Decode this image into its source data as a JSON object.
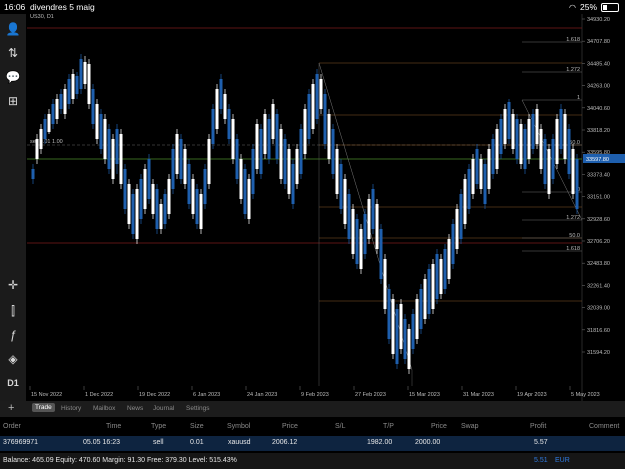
{
  "status": {
    "time": "16:06",
    "date": "divendres 5 maig",
    "battery": "25%"
  },
  "chart": {
    "symbol": "US30, D1",
    "sell_label": "sell 0.01 1.00",
    "price_ticks": [
      "34930.20",
      "34707.80",
      "34485.40",
      "34263.00",
      "34040.60",
      "33818.20",
      "33595.80",
      "33373.40",
      "33151.00",
      "32928.60",
      "32706.20",
      "32483.80",
      "32261.40",
      "32039.00",
      "31816.60",
      "31594.20"
    ],
    "current_price": "33597.80",
    "date_ticks": [
      "15 Nov 2022",
      "1 Dec 2022",
      "19 Dec 2022",
      "6 Jan 2023",
      "24 Jan 2023",
      "9 Feb 2023",
      "27 Feb 2023",
      "15 Mar 2023",
      "31 Mar 2023",
      "19 Apr 2023",
      "5 May 2023"
    ],
    "fib_labels": [
      "1.618",
      "1.272",
      "1",
      "0",
      "1.618",
      "0",
      "50.0",
      "0",
      "1.272",
      "50.0",
      "1.618"
    ],
    "colors": {
      "bull": "#ffffff",
      "bear": "#1e5fae",
      "grid_red": "#7a1a1a",
      "green_line": "#4a8a2a",
      "price_badge": "#1e5fae"
    }
  },
  "sidebar": {
    "timeframe": "D1"
  },
  "terminal": {
    "tabs": [
      "Trade",
      "History",
      "Mailbox",
      "News",
      "Journal",
      "Settings"
    ],
    "headers": [
      "Order",
      "Time",
      "Type",
      "Size",
      "Symbol",
      "Price",
      "S/L",
      "T/P",
      "Price",
      "Swap",
      "Profit",
      "Comment"
    ],
    "row": {
      "order": "376969971",
      "time": "05.05 16:23",
      "type": "sell",
      "size": "0.01",
      "symbol": "xauusd",
      "price": "2006.12",
      "sl": "",
      "tp": "1982.00",
      "cur_price": "2000.00",
      "swap": "",
      "profit": "5.57",
      "comment": ""
    },
    "balance_line": "Balance: 465.09 Equity: 470.60 Margin: 91.30 Free: 379.30 Level: 515.43%",
    "total_profit": "5.51",
    "currency": "EUR"
  }
}
